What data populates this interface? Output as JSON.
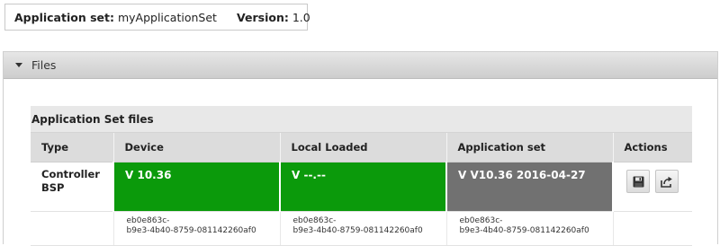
{
  "info": {
    "app_set_label": "Application set:",
    "app_set_value": "myApplicationSet",
    "version_label": "Version:",
    "version_value": "1.0"
  },
  "panel": {
    "title": "Files"
  },
  "table": {
    "caption": "Application Set files",
    "columns": [
      "Type",
      "Device",
      "Local Loaded",
      "Application set",
      "Actions"
    ],
    "row": {
      "type_line1": "Controller",
      "type_line2": "BSP",
      "device": "V 10.36",
      "local_loaded": "V --.--",
      "application_set": "V V10.36 2016-04-27",
      "device_color": "#0b9a0b",
      "local_color": "#0b9a0b",
      "appset_color": "#717171"
    },
    "hashes": {
      "device_1": "eb0e863c-",
      "device_2": "b9e3-4b40-8759-081142260af0",
      "local_1": "eb0e863c-",
      "local_2": "b9e3-4b40-8759-081142260af0",
      "appset_1": "eb0e863c-",
      "appset_2": "b9e3-4b40-8759-081142260af0"
    },
    "actions": [
      "save-icon",
      "export-icon"
    ]
  }
}
